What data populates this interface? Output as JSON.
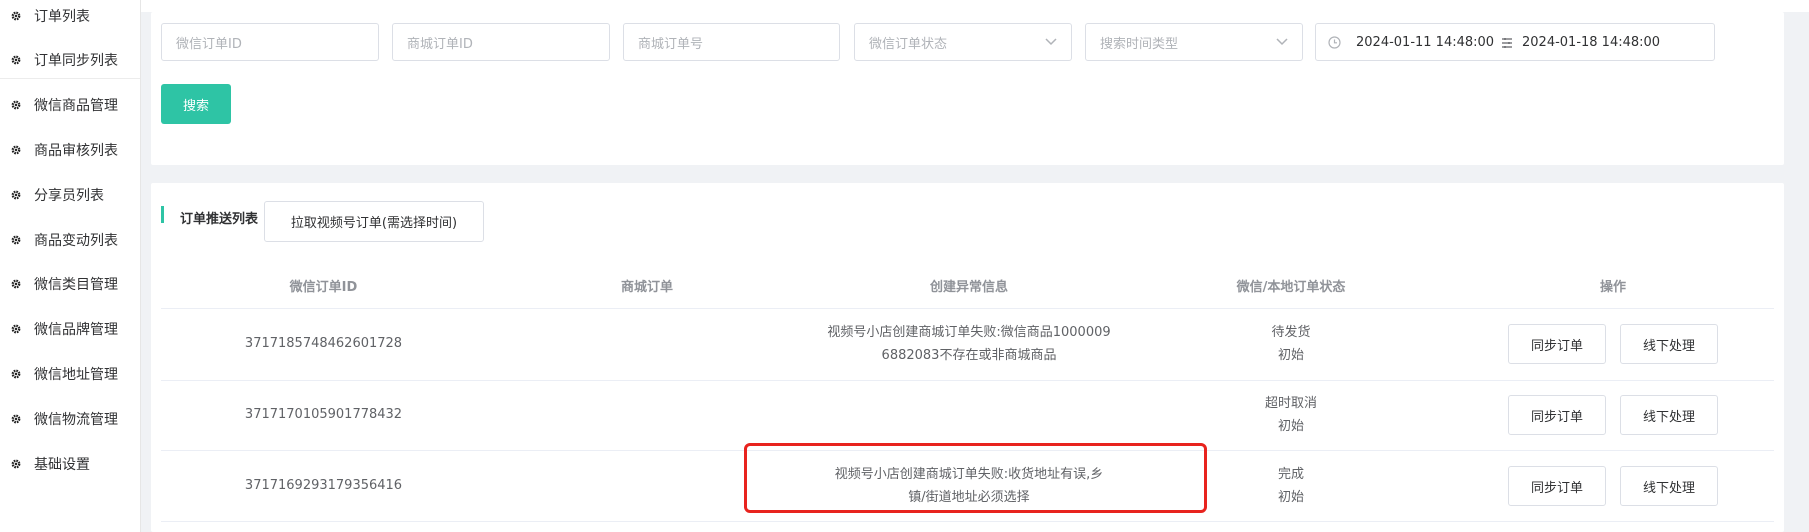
{
  "sidebar": {
    "items": [
      {
        "label": "订单列表"
      },
      {
        "label": "订单同步列表"
      },
      {
        "label": "微信商品管理"
      },
      {
        "label": "商品审核列表"
      },
      {
        "label": "分享员列表"
      },
      {
        "label": "商品变动列表"
      },
      {
        "label": "微信类目管理"
      },
      {
        "label": "微信品牌管理"
      },
      {
        "label": "微信地址管理"
      },
      {
        "label": "微信物流管理"
      },
      {
        "label": "基础设置"
      }
    ]
  },
  "filters": {
    "wechat_order_id_placeholder": "微信订单ID",
    "mall_order_id_placeholder": "商城订单ID",
    "mall_order_no_placeholder": "商城订单号",
    "wechat_order_status_placeholder": "微信订单状态",
    "time_type_placeholder": "搜索时间类型",
    "date_start": "2024-01-11 14:48:00",
    "date_end": "2024-01-18 14:48:00",
    "search_label": "搜索"
  },
  "list": {
    "title": "订单推送列表",
    "pull_button_label": "拉取视频号订单(需选择时间)",
    "columns": [
      "微信订单ID",
      "商城订单",
      "创建异常信息",
      "微信/本地订单状态",
      "操作"
    ],
    "rows": [
      {
        "wechat_order_id": "3717185748462601728",
        "mall_order": "",
        "error_line1": "视频号小店创建商城订单失败:微信商品1000009",
        "error_line2": "6882083不存在或非商城商品",
        "wechat_status": "待发货",
        "local_status": "初始"
      },
      {
        "wechat_order_id": "3717170105901778432",
        "mall_order": "",
        "error_line1": "",
        "error_line2": "",
        "wechat_status": "超时取消",
        "local_status": "初始"
      },
      {
        "wechat_order_id": "3717169293179356416",
        "mall_order": "",
        "error_line1": "视频号小店创建商城订单失败:收货地址有误,乡",
        "error_line2": "镇/街道地址必须选择",
        "wechat_status": "完成",
        "local_status": "初始"
      }
    ],
    "sync_label": "同步订单",
    "offline_label": "线下处理"
  },
  "colors": {
    "accent": "#2ec4a5",
    "highlight": "#e8231e"
  },
  "icons": {
    "nav": "gear-icon",
    "select": "chevron-down-icon",
    "clock": "clock-icon",
    "range_separator": "range-separator-icon"
  }
}
